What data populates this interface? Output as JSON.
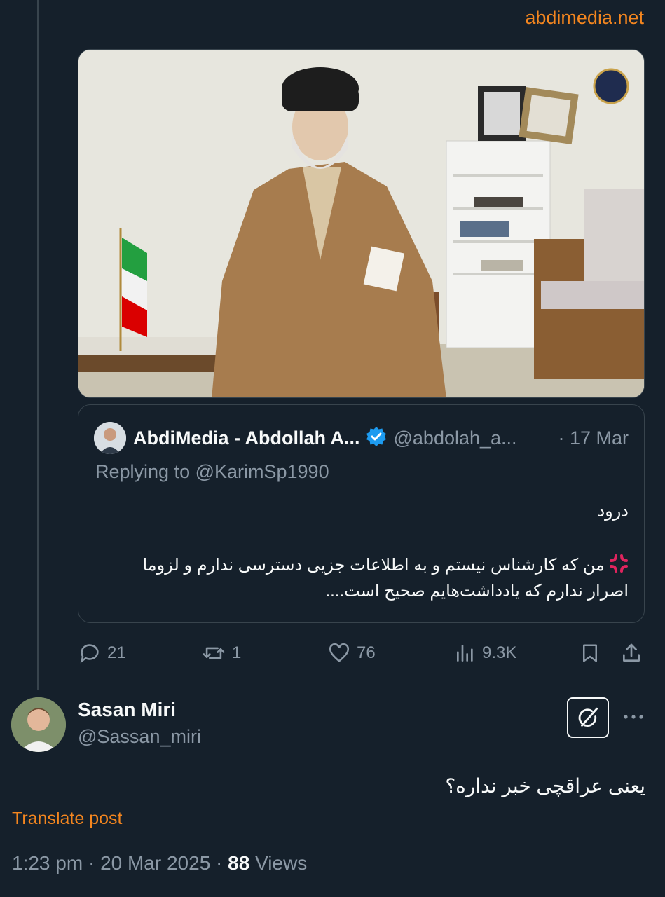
{
  "link_preview": {
    "domain": "abdimedia.net"
  },
  "quoted_post": {
    "author_name": "AbdiMedia - Abdollah A...",
    "author_handle": "@abdolah_a...",
    "date": "· 17 Mar",
    "replying_to": "Replying to @KarimSp1990",
    "body_line1": "درود",
    "body_line2": "من که کارشناس نیستم و به اطلاعات جزیی دسترسی ندارم و لزوما اصرار ندارم که یادداشت‌هایم صحیح است....",
    "emoji": "anger-symbol-icon"
  },
  "actions": {
    "replies": "21",
    "reposts": "1",
    "likes": "76",
    "views": "9.3K"
  },
  "reply": {
    "author_name": "Sasan Miri",
    "author_handle": "@Sassan_miri",
    "text": "یعنی عراقچی خبر نداره؟",
    "translate_label": "Translate post",
    "time": "1:23 pm",
    "date": "20 Mar 2025",
    "views_count": "88",
    "views_label": "Views"
  },
  "colors": {
    "background": "#15202b",
    "accent": "#f4861f",
    "muted": "#8b98a5",
    "verified": "#1d9bf0"
  }
}
